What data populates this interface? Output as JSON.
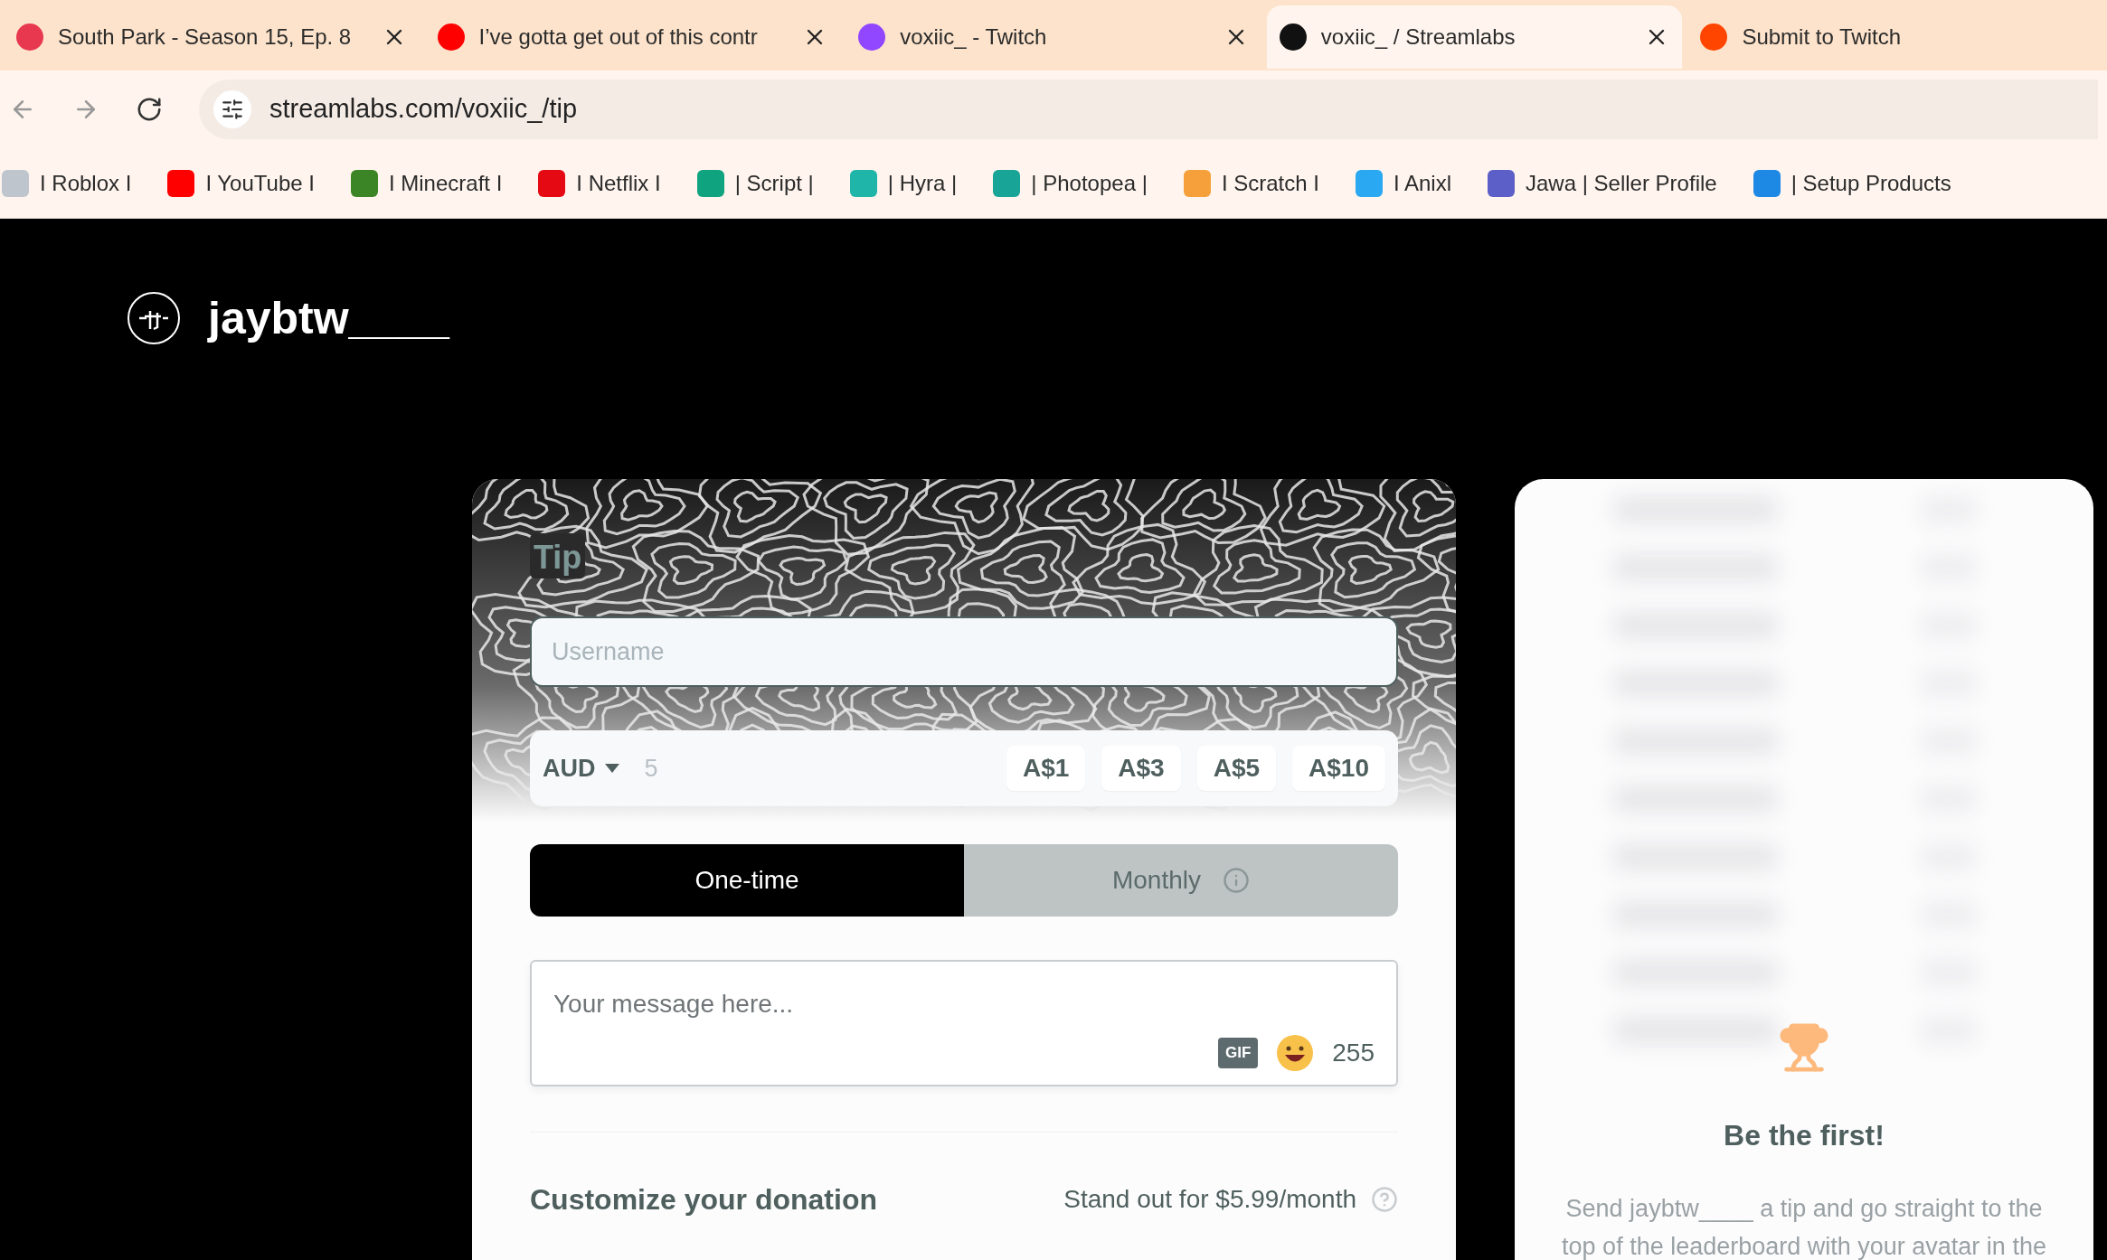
{
  "browser": {
    "tabs": [
      {
        "title": "South Park - Season 15, Ep. 8",
        "selected": false,
        "closable": true
      },
      {
        "title": "I’ve gotta get out of this contr",
        "selected": false,
        "closable": true
      },
      {
        "title": "voxiic_ - Twitch",
        "selected": false,
        "closable": true
      },
      {
        "title": "voxiic_ / Streamlabs",
        "selected": true,
        "closable": true
      },
      {
        "title": "Submit to Twitch",
        "selected": false,
        "closable": false
      }
    ],
    "address": "streamlabs.com/voxiic_/tip",
    "bookmarks": [
      "I Roblox I",
      "I YouTube I",
      "I Minecraft I",
      "I Netflix I",
      "| Script |",
      "| Hyra |",
      "| Photopea |",
      "I Scratch I",
      "I Anixl",
      "Jawa | Seller Profile",
      "| Setup Products"
    ]
  },
  "profile": {
    "name": "jaybtw____"
  },
  "tip_form": {
    "title": "Tip",
    "username_placeholder": "Username",
    "currency": "AUD",
    "amount_placeholder": "5",
    "presets": [
      "A$1",
      "A$3",
      "A$5",
      "A$10"
    ],
    "frequency": [
      {
        "label": "One-time",
        "selected": true
      },
      {
        "label": "Monthly",
        "selected": false
      }
    ],
    "message_placeholder": "Your message here...",
    "gif_label": "GIF",
    "char_count": "255",
    "customize_title": "Customize your donation",
    "customize_offer": "Stand out for $5.99/month"
  },
  "leaderboard": {
    "title": "Be the first!",
    "text": "Send jaybtw____ a tip and go straight to the top of the leaderboard with your avatar in the"
  }
}
